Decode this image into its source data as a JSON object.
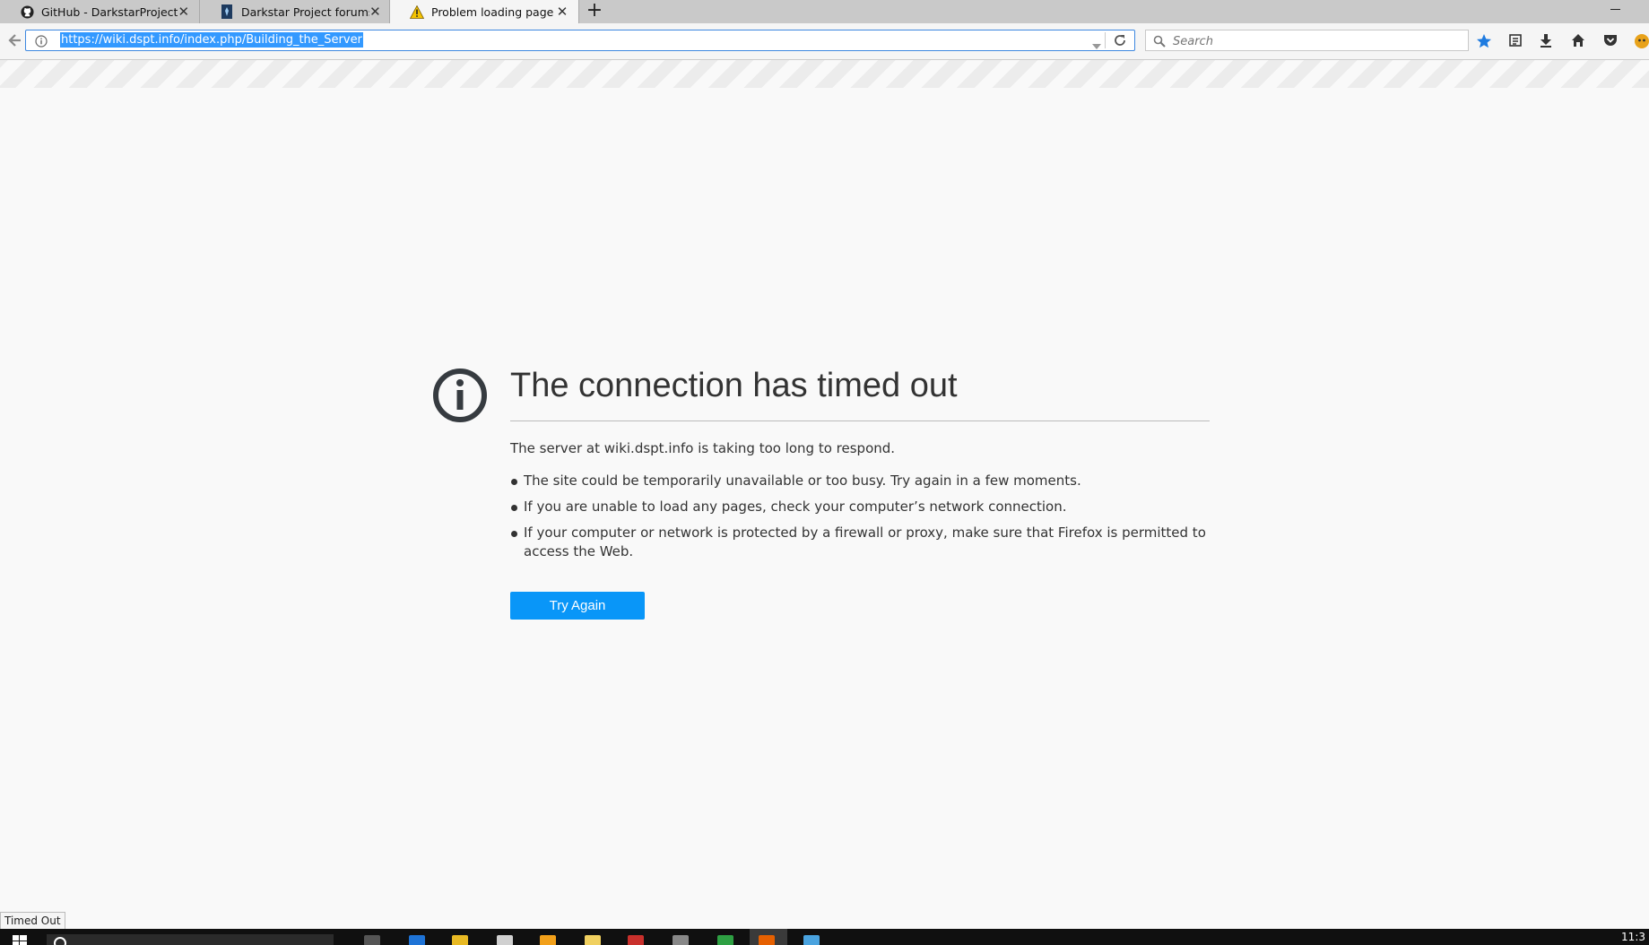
{
  "tabs": [
    {
      "title": "GitHub - DarkstarProject/...",
      "icon": "github-icon"
    },
    {
      "title": "Darkstar Project forums - ...",
      "icon": "forum-favicon"
    },
    {
      "title": "Problem loading page",
      "icon": "warning-icon",
      "active": true
    }
  ],
  "navbar": {
    "url": "https://wiki.dspt.info/index.php/Building_the_Server",
    "search_placeholder": "Search"
  },
  "error": {
    "title": "The connection has timed out",
    "description": "The server at wiki.dspt.info is taking too long to respond.",
    "reasons": [
      "The site could be temporarily unavailable or too busy. Try again in a few moments.",
      "If you are unable to load any pages, check your computer’s network connection.",
      "If your computer or network is protected by a firewall or proxy, make sure that Firefox is permitted to access the Web."
    ],
    "button_label": "Try Again"
  },
  "status_text": "Timed Out",
  "clock": "11:3",
  "colors": {
    "accent": "#0996f8",
    "url_highlight": "#3399ff",
    "bookmark_star": "#1e7be0"
  }
}
